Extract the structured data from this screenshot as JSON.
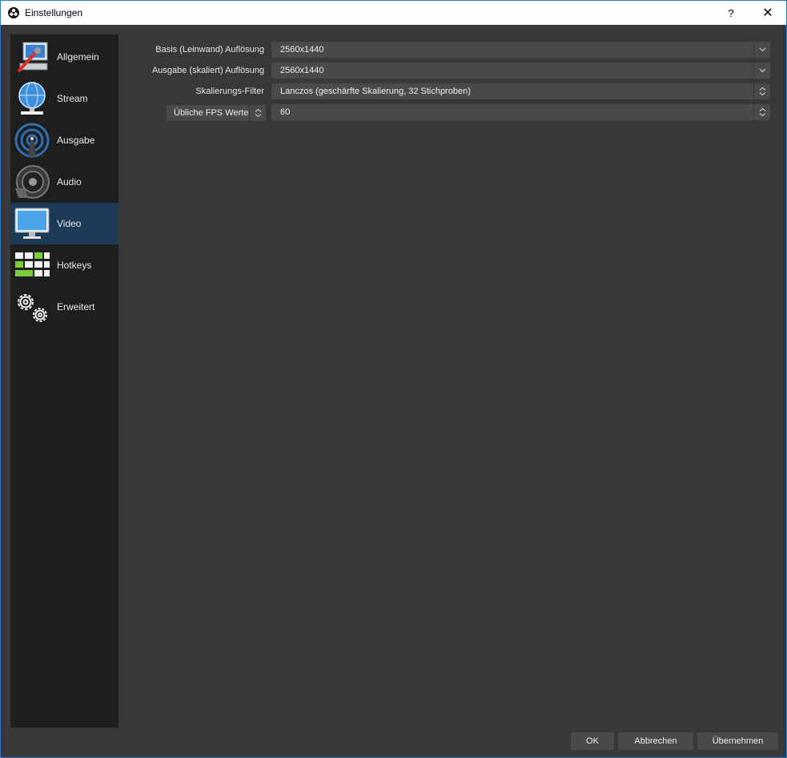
{
  "window": {
    "title": "Einstellungen",
    "help_label": "?",
    "close_label": "✕"
  },
  "sidebar": {
    "items": [
      {
        "label": "Allgemein",
        "icon": "general-settings-icon"
      },
      {
        "label": "Stream",
        "icon": "globe-stream-icon"
      },
      {
        "label": "Ausgabe",
        "icon": "broadcast-antenna-icon"
      },
      {
        "label": "Audio",
        "icon": "speaker-icon"
      },
      {
        "label": "Video",
        "icon": "monitor-icon"
      },
      {
        "label": "Hotkeys",
        "icon": "keyboard-icon"
      },
      {
        "label": "Erweitert",
        "icon": "gears-icon"
      }
    ],
    "active": "Video"
  },
  "video": {
    "base_resolution": {
      "label": "Basis (Leinwand) Auflösung",
      "value": "2560x1440"
    },
    "output_resolution": {
      "label": "Ausgabe (skaliert) Auflösung",
      "value": "2560x1440"
    },
    "scale_filter": {
      "label": "Skalierungs-Filter",
      "value": "Lanczos (geschärfte Skalierung, 32 Stichproben)"
    },
    "fps": {
      "type_label": "Übliche FPS Werte",
      "value": "60"
    }
  },
  "buttons": {
    "ok": "OK",
    "cancel": "Abbrechen",
    "apply": "Übernehmen"
  },
  "colors": {
    "accent": "#2a7ac9",
    "active_item": "#1a3a55",
    "background": "#383838",
    "sidebar": "#1e1e1e"
  }
}
